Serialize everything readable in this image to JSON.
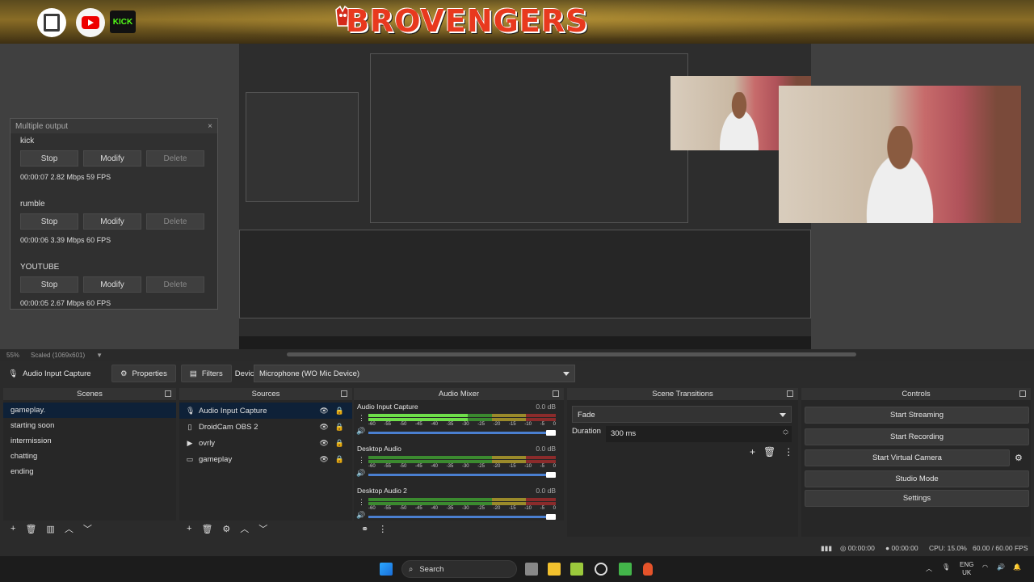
{
  "banner": {
    "brand": "BROVENGERS",
    "social": [
      "twitch-icon",
      "youtube-icon",
      "kick-icon"
    ],
    "kick_label": "KICK"
  },
  "multiple_output": {
    "title": "Multiple output",
    "close": "×",
    "outputs": [
      {
        "name": "kick",
        "stop": "Stop",
        "modify": "Modify",
        "delete": "Delete",
        "stats": "00:00:07  2.82 Mbps  59 FPS"
      },
      {
        "name": "rumble",
        "stop": "Stop",
        "modify": "Modify",
        "delete": "Delete",
        "stats": "00:00:06  3.39 Mbps  60 FPS"
      },
      {
        "name": "YOUTUBE",
        "stop": "Stop",
        "modify": "Modify",
        "delete": "Delete",
        "stats": "00:00:05  2.67 Mbps  60 FPS"
      }
    ]
  },
  "strip": {
    "zoom": "55%",
    "scale": "Scaled (1069x601)"
  },
  "propbar": {
    "source": "Audio Input Capture",
    "properties": "Properties",
    "filters": "Filters",
    "device_label": "Device",
    "device_value": "Microphone (WO Mic Device)"
  },
  "scenes": {
    "title": "Scenes",
    "items": [
      "gameplay.",
      "starting soon",
      "intermission",
      "chatting",
      "ending"
    ]
  },
  "sources": {
    "title": "Sources",
    "items": [
      {
        "name": "Audio Input Capture",
        "icon": "mic-icon"
      },
      {
        "name": "DroidCam OBS 2",
        "icon": "file-icon"
      },
      {
        "name": "ovrly",
        "icon": "play-icon"
      },
      {
        "name": "gameplay",
        "icon": "monitor-icon"
      }
    ]
  },
  "mixer": {
    "title": "Audio Mixer",
    "ticks": [
      "-60",
      "-55",
      "-50",
      "-45",
      "-40",
      "-35",
      "-30",
      "-25",
      "-20",
      "-15",
      "-10",
      "-5",
      "0"
    ],
    "channels": [
      {
        "name": "Audio Input Capture",
        "db": "0.0 dB"
      },
      {
        "name": "Desktop Audio",
        "db": "0.0 dB"
      },
      {
        "name": "Desktop Audio 2",
        "db": "0.0 dB"
      }
    ]
  },
  "transitions": {
    "title": "Scene Transitions",
    "selected": "Fade",
    "duration_label": "Duration",
    "duration_value": "300 ms"
  },
  "controls": {
    "title": "Controls",
    "start_streaming": "Start Streaming",
    "start_recording": "Start Recording",
    "start_virtual_camera": "Start Virtual Camera",
    "studio_mode": "Studio Mode",
    "settings": "Settings"
  },
  "statusbar": {
    "stream_time": "00:00:00",
    "rec_time": "00:00:00",
    "cpu": "CPU: 15.0%",
    "fps": "60.00 / 60.00 FPS"
  },
  "taskbar": {
    "search": "Search",
    "lang": "ENG",
    "region": "UK"
  },
  "colors": {
    "accent": "#0e2138",
    "brand": "#e8391e"
  }
}
